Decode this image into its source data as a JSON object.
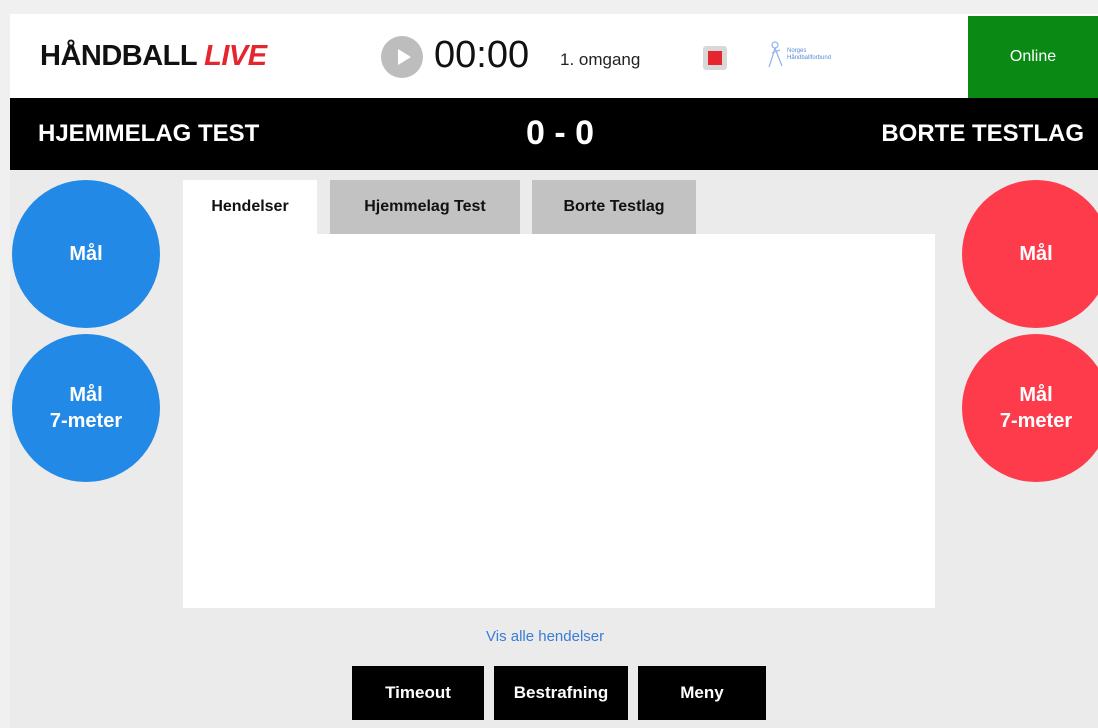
{
  "header": {
    "brand_main": "HÅNDBALL",
    "brand_accent": "LIVE",
    "timer": "00:00",
    "period": "1. omgang",
    "federation_line1": "Norges",
    "federation_line2": "Håndballforbund",
    "status": "Online"
  },
  "scoreboard": {
    "home_team": "HJEMMELAG TEST",
    "score": "0 - 0",
    "away_team": "BORTE TESTLAG"
  },
  "home_actions": {
    "goal": "Mål",
    "seven_meter_line1": "Mål",
    "seven_meter_line2": "7-meter"
  },
  "away_actions": {
    "goal": "Mål",
    "seven_meter_line1": "Mål",
    "seven_meter_line2": "7-meter"
  },
  "tabs": [
    {
      "label": "Hendelser",
      "active": true
    },
    {
      "label": "Hjemmelag Test",
      "active": false
    },
    {
      "label": "Borte Testlag",
      "active": false
    }
  ],
  "events_link": "Vis alle hendelser",
  "bottom_buttons": {
    "timeout": "Timeout",
    "penalty": "Bestrafning",
    "menu": "Meny"
  },
  "colors": {
    "home": "#2289e6",
    "away": "#fd3b4a",
    "online": "#0a8a14",
    "brand_accent": "#e6262e"
  },
  "icons": [
    "play-icon",
    "stop-icon",
    "federation-logo-icon"
  ]
}
